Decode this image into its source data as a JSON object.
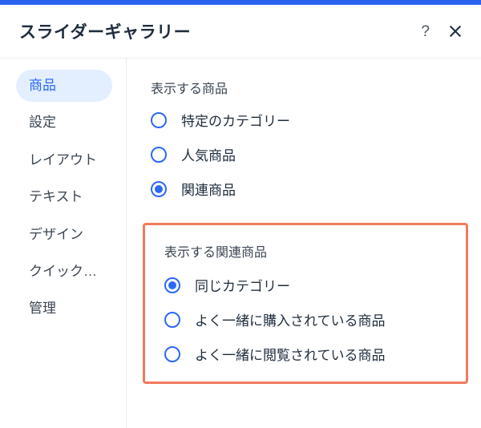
{
  "header": {
    "title": "スライダーギャラリー",
    "help": "?",
    "close": "×"
  },
  "sidebar": {
    "items": [
      {
        "label": "商品",
        "active": true
      },
      {
        "label": "設定",
        "active": false
      },
      {
        "label": "レイアウト",
        "active": false
      },
      {
        "label": "テキスト",
        "active": false
      },
      {
        "label": "デザイン",
        "active": false
      },
      {
        "label": "クイックビュー",
        "active": false
      },
      {
        "label": "管理",
        "active": false
      }
    ]
  },
  "content": {
    "display_products": {
      "label": "表示する商品",
      "options": [
        {
          "label": "特定のカテゴリー",
          "selected": false
        },
        {
          "label": "人気商品",
          "selected": false
        },
        {
          "label": "関連商品",
          "selected": true
        }
      ]
    },
    "related_products": {
      "label": "表示する関連商品",
      "options": [
        {
          "label": "同じカテゴリー",
          "selected": true
        },
        {
          "label": "よく一緒に購入されている商品",
          "selected": false
        },
        {
          "label": "よく一緒に閲覧されている商品",
          "selected": false
        }
      ]
    }
  }
}
